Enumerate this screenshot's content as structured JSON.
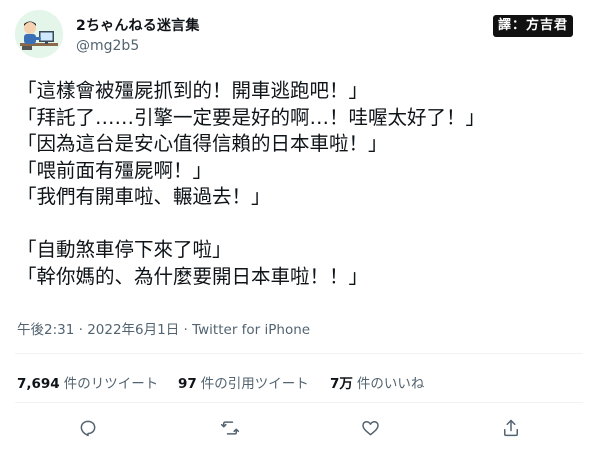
{
  "user": {
    "display_name": "2ちゃんねる迷言集",
    "handle": "@mg2b5",
    "avatar_icon": "avatar-person-at-computer-icon"
  },
  "overlay": {
    "translator_badge": "譯：方吉君"
  },
  "tweet": {
    "lines": [
      "「這樣會被殭屍抓到的！開車逃跑吧！」",
      "「拜託了……引擎一定要是好的啊…！哇喔太好了！」",
      "「因為這台是安心值得信賴的日本車啦！」",
      "「喂前面有殭屍啊！」",
      "「我們有開車啦、輾過去！」",
      "",
      "「自動煞車停下來了啦」",
      "「幹你媽的、為什麼要開日本車啦！！」"
    ]
  },
  "meta": {
    "time": "午後2:31",
    "sep1": " · ",
    "date": "2022年6月1日",
    "sep2": " · ",
    "source": "Twitter for iPhone"
  },
  "stats": {
    "retweets_count": "7,694",
    "retweets_label": "件のリツイート",
    "quotes_count": "97",
    "quotes_label": "件の引用ツイート",
    "likes_count": "7万",
    "likes_label": "件のいいね"
  },
  "actions": {
    "reply_icon": "reply-icon",
    "retweet_icon": "retweet-icon",
    "like_icon": "heart-icon",
    "share_icon": "share-icon"
  },
  "colors": {
    "text": "#0f1419",
    "muted": "#536471",
    "divider": "#eff3f4",
    "badge_bg": "#111111"
  }
}
